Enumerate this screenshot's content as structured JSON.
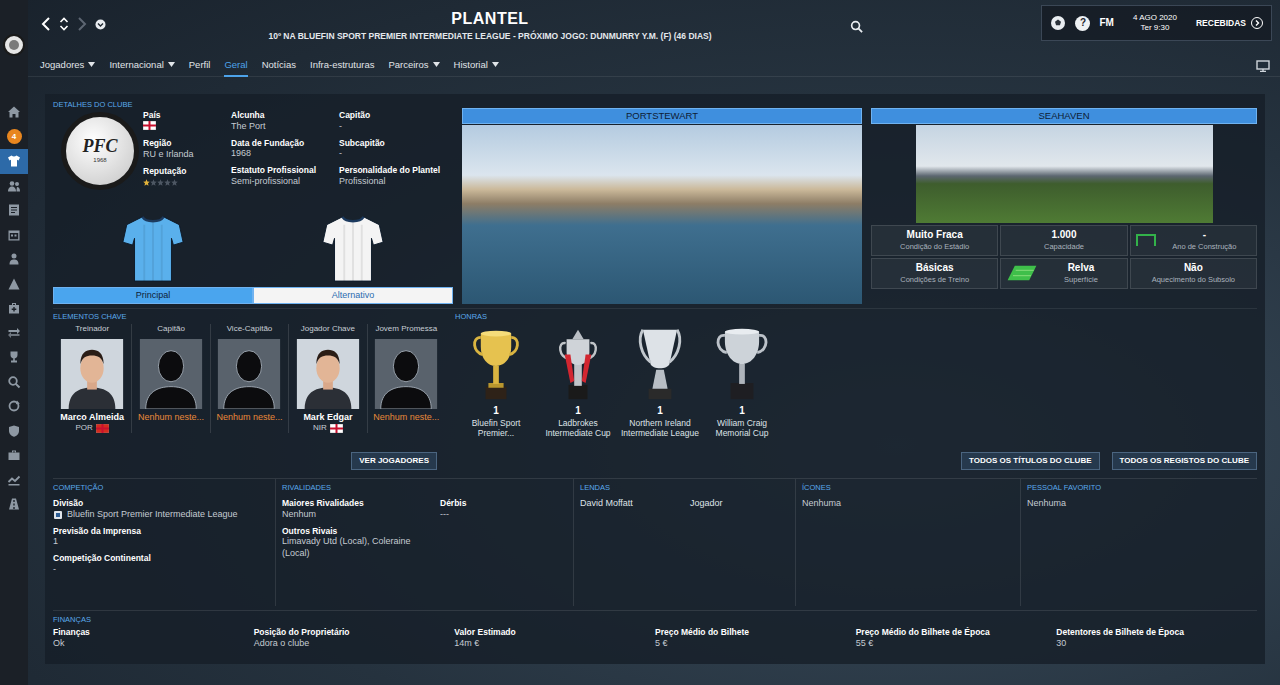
{
  "sidebar": {
    "items": [
      {
        "selected": false
      },
      {
        "selected": false,
        "badge": "4"
      },
      {
        "selected": true
      },
      {
        "selected": false
      },
      {
        "selected": false
      },
      {
        "selected": false
      },
      {
        "selected": false
      },
      {
        "selected": false
      },
      {
        "selected": false
      },
      {
        "selected": false
      },
      {
        "selected": false
      },
      {
        "selected": false
      },
      {
        "selected": false
      },
      {
        "selected": false
      },
      {
        "selected": false
      },
      {
        "selected": false
      },
      {
        "selected": false
      }
    ]
  },
  "nav": {
    "back_enabled": true,
    "forward_enabled": false
  },
  "title": "PLANTEL",
  "subtitle": "10º NA BLUEFIN SPORT PREMIER INTERMEDIATE LEAGUE - PRÓXIMO JOGO: DUNMURRY Y.M. (F) (46 DIAS)",
  "topbar": {
    "help": "?",
    "brand": "FM",
    "date": "4 AGO 2020",
    "time": "Ter 9:30",
    "inbox": "RECEBIDAS"
  },
  "tabs": [
    {
      "label": "Jogadores",
      "dropdown": true,
      "selected": false
    },
    {
      "label": "Internacional",
      "dropdown": true,
      "selected": false
    },
    {
      "label": "Perfil",
      "dropdown": false,
      "selected": false
    },
    {
      "label": "Geral",
      "dropdown": false,
      "selected": true
    },
    {
      "label": "Notícias",
      "dropdown": false,
      "selected": false
    },
    {
      "label": "Infra-estruturas",
      "dropdown": false,
      "selected": false
    },
    {
      "label": "Parceiros",
      "dropdown": true,
      "selected": false
    },
    {
      "label": "Historial",
      "dropdown": true,
      "selected": false
    }
  ],
  "club": {
    "section": "DETALHES DO CLUBE",
    "logo": {
      "initials": "PFC",
      "year": "1968"
    },
    "columns": [
      [
        {
          "label": "País",
          "kind": "flag"
        },
        {
          "label": "Região",
          "kind": "text",
          "value": "RU e Irlanda"
        },
        {
          "label": "Reputação",
          "kind": "stars",
          "stars": 1
        }
      ],
      [
        {
          "label": "Alcunha",
          "kind": "text",
          "value": "The Port"
        },
        {
          "label": "Data de Fundação",
          "kind": "text",
          "value": "1968"
        },
        {
          "label": "Estatuto Profissional",
          "kind": "text",
          "value": "Semi-profissional"
        }
      ],
      [
        {
          "label": "Capitão",
          "kind": "text",
          "value": "-"
        },
        {
          "label": "Subcapitão",
          "kind": "text",
          "value": "-"
        },
        {
          "label": "Personalidade do Plantel",
          "kind": "text",
          "value": "Profissional"
        }
      ]
    ],
    "kits": [
      {
        "label": "Principal",
        "selected": true,
        "color": "#5ab0ec"
      },
      {
        "label": "Alternativo",
        "selected": false,
        "color": "#f4f4f4"
      }
    ]
  },
  "city": {
    "name": "PORTSTEWART"
  },
  "stadium": {
    "name": "SEAHAVEN",
    "stats": [
      {
        "value": "Muito Fraca",
        "label": "Condição do Estádio"
      },
      {
        "value": "1.000",
        "label": "Capacidade"
      },
      {
        "value": "-",
        "label": "Ano de Construção"
      },
      {
        "value": "Básicas",
        "label": "Condições de Treino"
      },
      {
        "value": "Relva",
        "label": "Superfície"
      },
      {
        "value": "Não",
        "label": "Aquecimento do Subsolo"
      }
    ]
  },
  "key_elements": {
    "section": "ELEMENTOS CHAVE",
    "button": "VER JOGADORES",
    "people": [
      {
        "role": "Treinador",
        "name": "Marco Almeida",
        "nation": "POR",
        "kind": "person",
        "color": "#d52b1e"
      },
      {
        "role": "Capitão",
        "name": "Nenhum neste...",
        "kind": "vacant"
      },
      {
        "role": "Vice-Capitão",
        "name": "Nenhum neste...",
        "kind": "vacant"
      },
      {
        "role": "Jogador Chave",
        "name": "Mark Edgar",
        "nation": "NIR",
        "kind": "person",
        "color": "#ffffff"
      },
      {
        "role": "Jovem Promessa",
        "name": "Nenhum neste...",
        "kind": "vacant"
      }
    ]
  },
  "honours": {
    "section": "HONRAS",
    "items": [
      {
        "count": "1",
        "name": "Bluefin Sport Premier..."
      },
      {
        "count": "1",
        "name": "Ladbrokes Intermediate Cup"
      },
      {
        "count": "1",
        "name": "Northern Ireland Intermediate League"
      },
      {
        "count": "1",
        "name": "William Craig Memorial Cup"
      }
    ],
    "buttons": [
      "TODOS OS TÍTULOS DO CLUBE",
      "TODOS OS REGISTOS DO CLUBE"
    ]
  },
  "competition": {
    "section": "COMPETIÇÃO",
    "fields": [
      {
        "label": "Divisão",
        "value": "Bluefin Sport Premier Intermediate League"
      },
      {
        "label": "Previsão da Imprensa",
        "value": "1"
      },
      {
        "label": "Competição Continental",
        "value": "-"
      }
    ]
  },
  "rivalries": {
    "section": "RIVALIDADES",
    "fields": [
      {
        "label": "Maiores Rivalidades",
        "value": "Nenhum"
      },
      {
        "label": "Dérbis",
        "value": "---"
      },
      {
        "label": "Outros Rivais",
        "value": "Limavady Utd (Local), Coleraine (Local)"
      }
    ]
  },
  "legends": {
    "section": "LENDAS",
    "rows": [
      {
        "name": "David Moffatt",
        "role": "Jogador"
      }
    ]
  },
  "icons": {
    "section": "ÍCONES",
    "value": "Nenhuma"
  },
  "favourite_staff": {
    "section": "PESSOAL FAVORITO",
    "value": "Nenhuma"
  },
  "finances": {
    "section": "FINANÇAS",
    "fields": [
      {
        "label": "Finanças",
        "value": "Ok"
      },
      {
        "label": "Posição do Proprietário",
        "value": "Adora o clube"
      },
      {
        "label": "Valor Estimado",
        "value": "14m €"
      },
      {
        "label": "Preço Médio do Bilhete",
        "value": "5 €"
      },
      {
        "label": "Preço Médio do Bilhete de Época",
        "value": "55 €"
      },
      {
        "label": "Detentores de Bilhete de Época",
        "value": "30"
      }
    ]
  }
}
